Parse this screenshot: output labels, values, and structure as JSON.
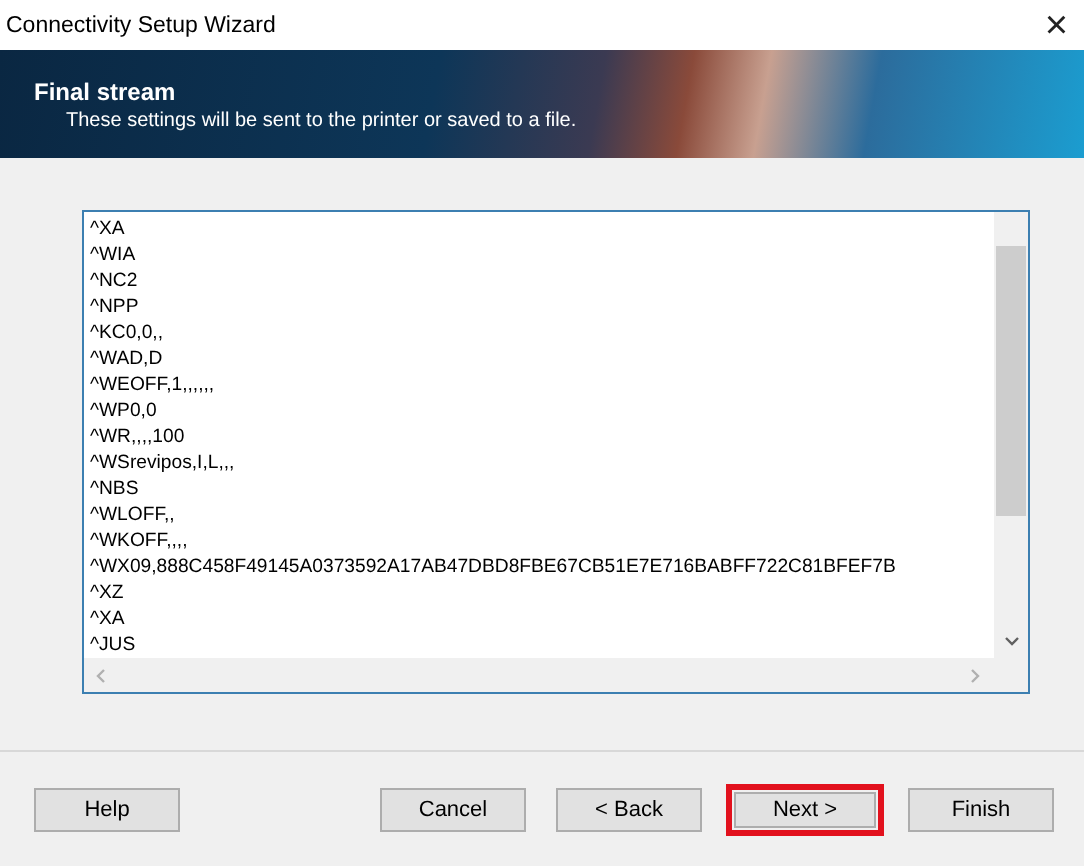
{
  "window": {
    "title": "Connectivity Setup Wizard",
    "close": "×"
  },
  "banner": {
    "title": "Final stream",
    "subtitle": "These settings will be sent to the printer or saved to a file."
  },
  "stream_lines": [
    "^XA",
    "^WIA",
    "^NC2",
    "^NPP",
    "^KC0,0,,",
    "^WAD,D",
    "^WEOFF,1,,,,,,",
    "^WP0,0",
    "^WR,,,,100",
    "^WSrevipos,I,L,,,",
    "^NBS",
    "^WLOFF,,",
    "^WKOFF,,,,",
    "^WX09,888C458F49145A0373592A17AB47DBD8FBE67CB51E7E716BABFF722C81BFEF7B",
    "^XZ",
    "^XA",
    "^JUS"
  ],
  "buttons": [
    {
      "label": "Help",
      "highlighted": false
    },
    {
      "label": "Cancel",
      "highlighted": false
    },
    {
      "label": "< Back",
      "highlighted": false
    },
    {
      "label": "Next >",
      "highlighted": true
    },
    {
      "label": "Finish",
      "highlighted": false
    }
  ]
}
